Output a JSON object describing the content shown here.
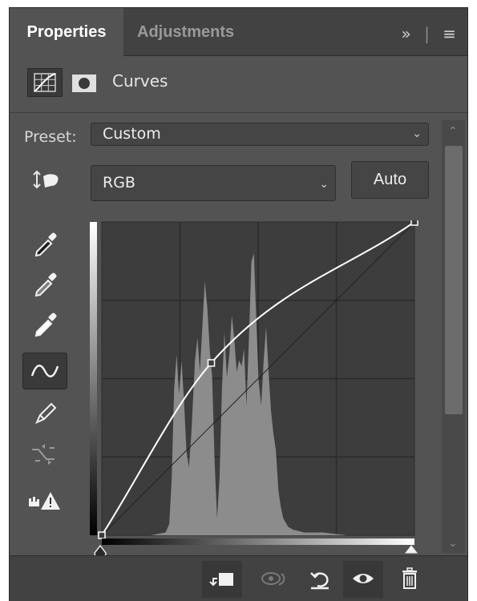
{
  "tabs": {
    "active": "Properties",
    "inactive": "Adjustments",
    "expand_glyph": "»",
    "menu_glyph": "≡"
  },
  "header": {
    "title": "Curves",
    "icons": [
      "curves-adjustment-icon",
      "layer-mask-icon"
    ]
  },
  "preset": {
    "label": "Preset:",
    "value": "Custom"
  },
  "channel": {
    "value": "RGB"
  },
  "auto_button": "Auto",
  "tools": [
    "on-image-adjust-icon",
    "black-point-eyedropper-icon",
    "gray-point-eyedropper-icon",
    "white-point-eyedropper-icon",
    "curve-point-tool-icon",
    "pencil-draw-icon",
    "smooth-curve-icon",
    "clipping-warning-icon"
  ],
  "curve": {
    "control_points": [
      [
        0,
        0
      ],
      [
        35,
        55
      ],
      [
        100,
        100
      ]
    ]
  },
  "footer": {
    "buttons": [
      "clip-to-layer-icon",
      "view-previous-state-icon",
      "reset-icon",
      "visibility-eye-icon",
      "delete-trash-icon"
    ]
  },
  "colors": {
    "panel_bg": "#535353",
    "tab_bar_bg": "#424242",
    "graph_bg": "#3d3d3d",
    "histogram": "#8c8c8c",
    "curve": "#ffffff"
  }
}
